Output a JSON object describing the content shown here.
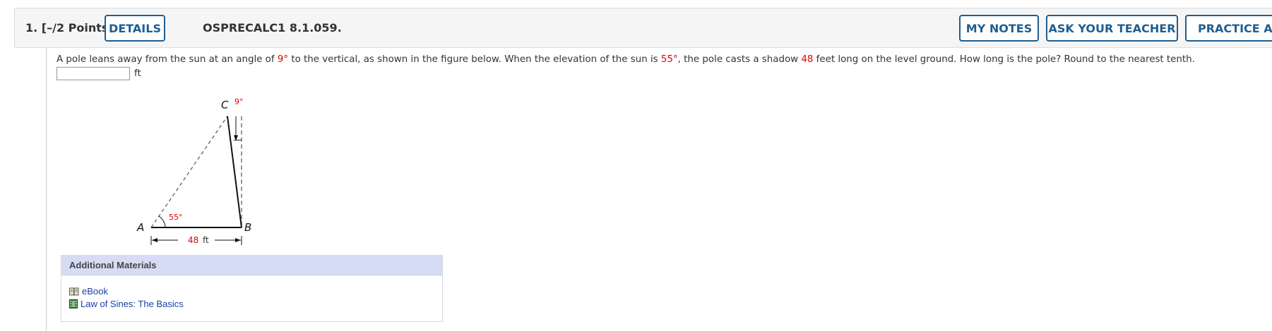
{
  "header": {
    "question_number": "1.",
    "points": "[–/2 Points]",
    "details_label": "DETAILS",
    "problem_code": "OSPRECALC1 8.1.059.",
    "my_notes_label": "MY NOTES",
    "ask_teacher_label": "ASK YOUR TEACHER",
    "practice_label": "PRACTICE ANOTHER"
  },
  "question": {
    "part1": "A pole leans away from the sun at an angle of ",
    "angle_lean": "9°",
    "part2": " to the vertical, as shown in the figure below. When the elevation of the sun is ",
    "angle_sun": "55°",
    "part3": ", the pole casts a shadow ",
    "shadow": "48",
    "part4": " feet long on the level ground. How long is the pole? Round to the nearest tenth.",
    "answer_value": "",
    "unit": "ft"
  },
  "figure": {
    "label_a": "A",
    "label_b": "B",
    "label_c": "C",
    "angle_top": "9°",
    "angle_bottom": "55°",
    "length_value": "48",
    "length_unit": "ft"
  },
  "additional_materials": {
    "title": "Additional Materials",
    "links": [
      {
        "label": "eBook",
        "icon": "book-icon"
      },
      {
        "label": "Law of Sines: The Basics",
        "icon": "film-icon"
      }
    ]
  }
}
